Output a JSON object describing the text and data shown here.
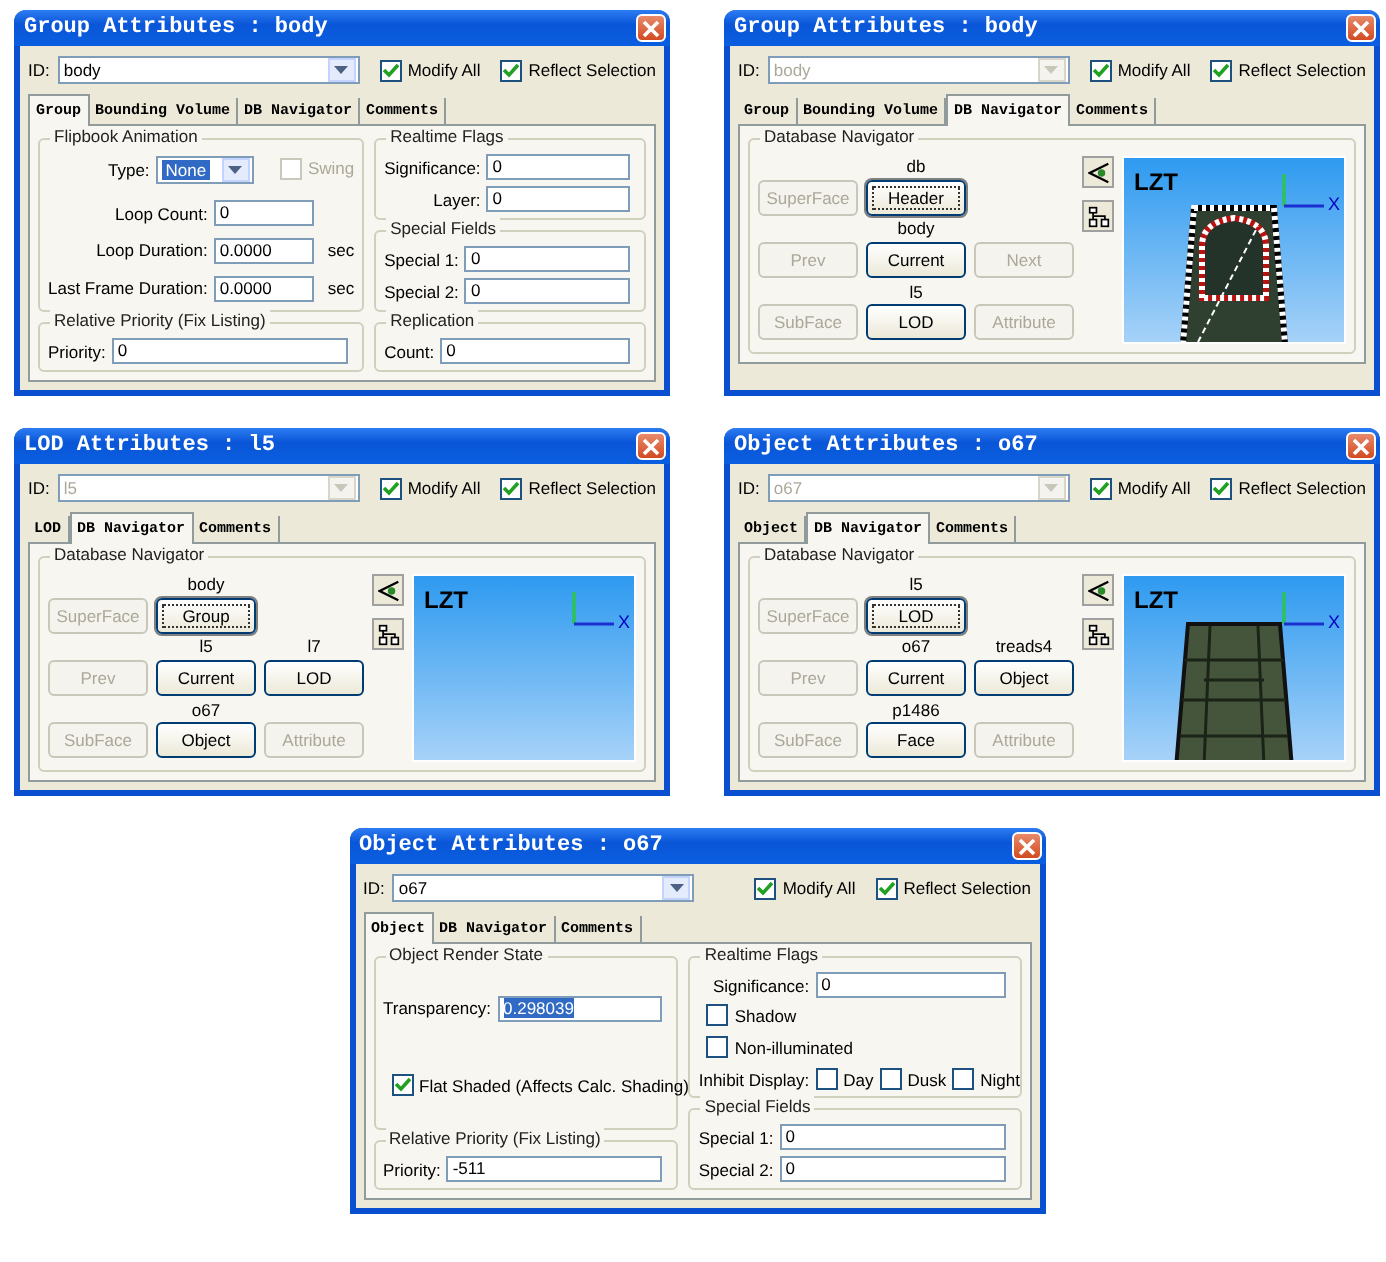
{
  "windows": [
    {
      "title": "Group Attributes : body",
      "id": {
        "label": "ID:",
        "value": "body",
        "disabled": false
      },
      "options": [
        {
          "label": "Modify All",
          "checked": true
        },
        {
          "label": "Reflect Selection",
          "checked": true
        }
      ],
      "tabs": [
        {
          "label": "Group",
          "selected": true
        },
        {
          "label": "Bounding Volume",
          "selected": false
        },
        {
          "label": "DB Navigator",
          "selected": false
        },
        {
          "label": "Comments",
          "selected": false
        }
      ],
      "panel": {
        "kind": "form",
        "columns": [
          [
            {
              "title": "Flipbook Animation",
              "rows": [
                {
                  "kind": "combo",
                  "label": "Type:",
                  "value": "None",
                  "selected": true,
                  "checkbox": {
                    "label": "Swing",
                    "checked": false,
                    "disabled": true
                  }
                },
                {
                  "kind": "field",
                  "label": "Loop Count:",
                  "value": "0",
                  "selected": false
                },
                {
                  "kind": "field",
                  "label": "Loop Duration:",
                  "value": "0.0000",
                  "unit": "sec",
                  "selected": false
                },
                {
                  "kind": "field",
                  "label": "Last Frame Duration:",
                  "value": "0.0000",
                  "unit": "sec",
                  "selected": false
                }
              ]
            },
            {
              "title": "Relative Priority (Fix Listing)",
              "rows": [
                {
                  "kind": "field",
                  "label": "Priority:",
                  "value": "0",
                  "selected": false
                }
              ]
            }
          ],
          [
            {
              "title": "Realtime Flags",
              "rows": [
                {
                  "kind": "field",
                  "label": "Significance:",
                  "value": "0",
                  "selected": false
                },
                {
                  "kind": "field",
                  "label": "Layer:",
                  "value": "0",
                  "selected": false
                }
              ]
            },
            {
              "title": "Special Fields",
              "rows": [
                {
                  "kind": "field",
                  "label": "Special 1:",
                  "value": "0",
                  "selected": false
                },
                {
                  "kind": "field",
                  "label": "Special 2:",
                  "value": "0",
                  "selected": false
                }
              ]
            },
            {
              "title": "Replication",
              "rows": [
                {
                  "kind": "field",
                  "label": "Count:",
                  "value": "0",
                  "selected": false
                }
              ]
            }
          ]
        ]
      }
    },
    {
      "title": "Group Attributes : body",
      "id": {
        "label": "ID:",
        "value": "body",
        "disabled": true
      },
      "options": [
        {
          "label": "Modify All",
          "checked": true
        },
        {
          "label": "Reflect Selection",
          "checked": true
        }
      ],
      "tabs": [
        {
          "label": "Group",
          "selected": false
        },
        {
          "label": "Bounding Volume",
          "selected": false
        },
        {
          "label": "DB Navigator",
          "selected": true
        },
        {
          "label": "Comments",
          "selected": false
        }
      ],
      "panel": {
        "kind": "navigator",
        "title": "Database Navigator",
        "rows": [
          [
            {
              "label": "SuperFace",
              "disabled": true
            },
            {
              "label": "Header",
              "caption": "db",
              "disabled": false,
              "focused": true
            }
          ],
          [
            {
              "label": "Prev",
              "disabled": true
            },
            {
              "label": "Current",
              "caption": "body",
              "disabled": false,
              "focused": false
            },
            {
              "label": "Next",
              "disabled": true
            }
          ],
          [
            {
              "label": "SubFace",
              "disabled": true
            },
            {
              "label": "LOD",
              "caption": "l5",
              "disabled": false,
              "focused": false
            },
            {
              "label": "Attribute",
              "disabled": true
            }
          ]
        ],
        "viewport": {
          "label": "LZT",
          "axis_label": "X",
          "model": {
            "kind": "frame"
          }
        }
      }
    },
    {
      "title": "LOD Attributes : l5",
      "id": {
        "label": "ID:",
        "value": "l5",
        "disabled": true
      },
      "options": [
        {
          "label": "Modify All",
          "checked": true
        },
        {
          "label": "Reflect Selection",
          "checked": true
        }
      ],
      "tabs": [
        {
          "label": "LOD",
          "selected": false
        },
        {
          "label": "DB Navigator",
          "selected": true
        },
        {
          "label": "Comments",
          "selected": false
        }
      ],
      "panel": {
        "kind": "navigator",
        "title": "Database Navigator",
        "rows": [
          [
            {
              "label": "SuperFace",
              "disabled": true
            },
            {
              "label": "Group",
              "caption": "body",
              "disabled": false,
              "focused": true
            }
          ],
          [
            {
              "label": "Prev",
              "disabled": true
            },
            {
              "label": "Current",
              "caption": "l5",
              "disabled": false,
              "focused": false
            },
            {
              "label": "LOD",
              "caption": "l7",
              "disabled": false,
              "focused": false
            }
          ],
          [
            {
              "label": "SubFace",
              "disabled": true
            },
            {
              "label": "Object",
              "caption": "o67",
              "disabled": false,
              "focused": false
            },
            {
              "label": "Attribute",
              "disabled": true
            }
          ]
        ],
        "viewport": {
          "label": "LZT",
          "axis_label": "X"
        }
      }
    },
    {
      "title": "Object Attributes : o67",
      "id": {
        "label": "ID:",
        "value": "o67",
        "disabled": true
      },
      "options": [
        {
          "label": "Modify All",
          "checked": true
        },
        {
          "label": "Reflect Selection",
          "checked": true
        }
      ],
      "tabs": [
        {
          "label": "Object",
          "selected": false
        },
        {
          "label": "DB Navigator",
          "selected": true
        },
        {
          "label": "Comments",
          "selected": false
        }
      ],
      "panel": {
        "kind": "navigator",
        "title": "Database Navigator",
        "rows": [
          [
            {
              "label": "SuperFace",
              "disabled": true
            },
            {
              "label": "LOD",
              "caption": "l5",
              "disabled": false,
              "focused": true
            }
          ],
          [
            {
              "label": "Prev",
              "disabled": true
            },
            {
              "label": "Current",
              "caption": "o67",
              "disabled": false,
              "focused": false
            },
            {
              "label": "Object",
              "caption": "treads4",
              "disabled": false,
              "focused": false
            }
          ],
          [
            {
              "label": "SubFace",
              "disabled": true
            },
            {
              "label": "Face",
              "caption": "p1486",
              "disabled": false,
              "focused": false
            },
            {
              "label": "Attribute",
              "disabled": true
            }
          ]
        ],
        "viewport": {
          "label": "LZT",
          "axis_label": "X",
          "model": {
            "kind": "slab"
          }
        }
      }
    },
    {
      "title": "Object Attributes : o67",
      "id": {
        "label": "ID:",
        "value": "o67",
        "disabled": false
      },
      "options": [
        {
          "label": "Modify All",
          "checked": true
        },
        {
          "label": "Reflect Selection",
          "checked": true
        }
      ],
      "tabs": [
        {
          "label": "Object",
          "selected": true
        },
        {
          "label": "DB Navigator",
          "selected": false
        },
        {
          "label": "Comments",
          "selected": false
        }
      ],
      "panel": {
        "kind": "form",
        "columns": [
          [
            {
              "title": "Object Render State",
              "rows": [
                {
                  "kind": "field",
                  "label": "Transparency:",
                  "value": "0.298039",
                  "selected": true
                },
                {
                  "kind": "checkbox",
                  "label": "Flat Shaded (Affects Calc. Shading)",
                  "checked": true
                }
              ]
            },
            {
              "title": "Relative Priority (Fix Listing)",
              "rows": [
                {
                  "kind": "field",
                  "label": "Priority:",
                  "value": "-511",
                  "selected": false
                }
              ]
            }
          ],
          [
            {
              "title": "Realtime Flags",
              "rows": [
                {
                  "kind": "field",
                  "label": "Significance:",
                  "value": "0",
                  "selected": false
                },
                {
                  "kind": "checkbox",
                  "label": "Shadow",
                  "checked": false
                },
                {
                  "kind": "checkbox",
                  "label": "Non-illuminated",
                  "checked": false
                },
                {
                  "kind": "checkgroup",
                  "label": "Inhibit Display:",
                  "items": [
                    {
                      "label": "Day",
                      "checked": false
                    },
                    {
                      "label": "Dusk",
                      "checked": false
                    },
                    {
                      "label": "Night",
                      "checked": false
                    }
                  ]
                }
              ]
            },
            {
              "title": "Special Fields",
              "rows": [
                {
                  "kind": "field",
                  "label": "Special 1:",
                  "value": "0",
                  "selected": false
                },
                {
                  "kind": "field",
                  "label": "Special 2:",
                  "value": "0",
                  "selected": false
                }
              ]
            }
          ]
        ]
      }
    }
  ]
}
